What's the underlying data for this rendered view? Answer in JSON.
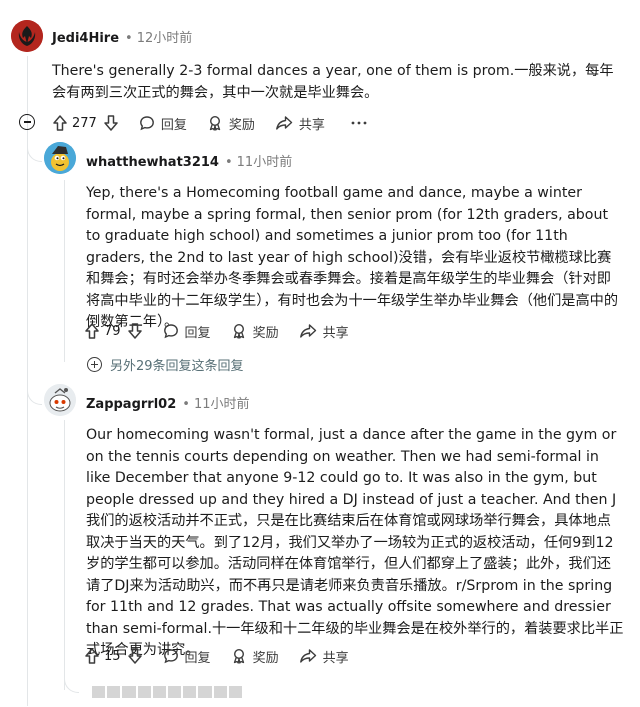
{
  "comments": [
    {
      "author": "Jedi4Hire",
      "time": "12小时前",
      "body": "There's generally 2-3 formal dances a year, one of them is prom.一般来说，每年会有两到三次正式的舞会，其中一次就是毕业舞会。",
      "votes": "277",
      "reply_label": "回复",
      "award_label": "奖励",
      "share_label": "共享"
    },
    {
      "author": "whatthewhat3214",
      "time": "11小时前",
      "body": "Yep, there's a Homecoming football game and dance, maybe a winter formal, maybe a spring formal, then senior prom (for 12th graders, about to graduate high school) and sometimes a junior prom too (for 11th graders, the 2nd to last year of high school)没错，会有毕业返校节橄榄球比赛和舞会；有时还会举办冬季舞会或春季舞会。接着是高年级学生的毕业舞会（针对即将高中毕业的十二年级学生），有时也会为十一年级学生举办毕业舞会（他们是高中的倒数第二年）。",
      "votes": "79",
      "reply_label": "回复",
      "award_label": "奖励",
      "share_label": "共享"
    },
    {
      "author": "Zappagrrl02",
      "time": "11小时前",
      "body": "Our homecoming wasn't formal, just a dance after the game in the gym or on the tennis courts depending on weather. Then we had semi-formal in like December that anyone 9-12 could go to. It was also in the gym, but people dressed up and they hired a DJ instead of just a teacher. And then J我们的返校活动并不正式，只是在比赛结束后在体育馆或网球场举行舞会，具体地点取决于当天的天气。到了12月，我们又举办了一场较为正式的返校活动，任何9到12岁的学生都可以参加。活动同样在体育馆举行，但人们都穿上了盛装；此外，我们还请了DJ来为活动助兴，而不再只是请老师来负责音乐播放。r/Srprom in the spring for 11th and 12 grades. That was actually offsite somewhere and dressier than semi-formal.十一年级和十二年级的毕业舞会是在校外举行的，着装要求比半正式场合更为讲究。",
      "votes": "15",
      "reply_label": "回复",
      "award_label": "奖励",
      "share_label": "共享"
    }
  ],
  "more_replies": "另外29条回复这条回复",
  "icons": {
    "upvote": "arrow-up-icon",
    "downvote": "arrow-down-icon",
    "reply": "speech-bubble-icon",
    "award": "award-ribbon-icon",
    "share": "share-arrow-icon",
    "more": "ellipsis-icon",
    "collapse": "minus-circle-icon",
    "expand": "plus-circle-icon"
  },
  "colors": {
    "text": "#1a1a1b",
    "muted": "#7c7c7c",
    "thread_line": "#e3e6e8",
    "avatar1_bg": "#b3261e"
  }
}
